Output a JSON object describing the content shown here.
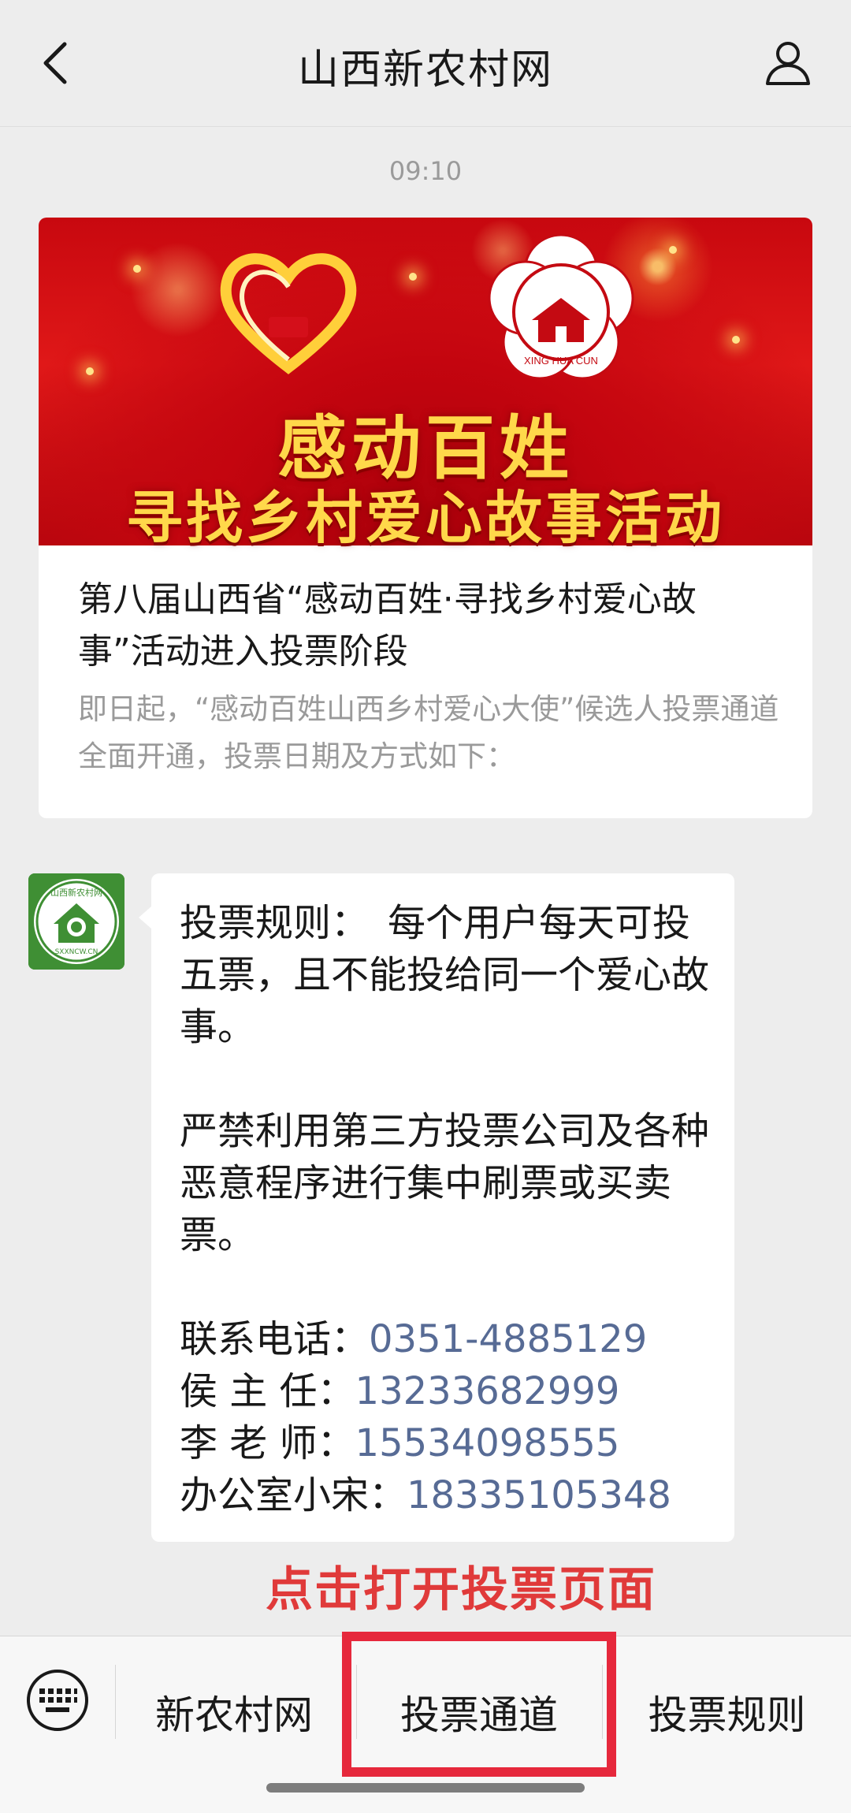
{
  "header": {
    "title": "山西新农村网",
    "back_icon": "chevron-left-icon",
    "profile_icon": "person-icon"
  },
  "timestamp": "09:10",
  "article": {
    "banner": {
      "line1": "感动百姓",
      "line2": "寻找乡村爱心故事活动",
      "flower_logo_text": "XING HUA CUN"
    },
    "title": "第八届山西省“感动百姓·寻找乡村爱心故事”活动进入投票阶段",
    "description": "即日起，“感动百姓山西乡村爱心大使”候选人投票通道全面开通，投票日期及方式如下："
  },
  "message": {
    "avatar_text": "山西新农村网",
    "avatar_site": "SXXNCW.CN",
    "paragraph1": "投票规则：　每个用户每天可投五票，且不能投给同一个爱心故事。",
    "paragraph2": "严禁利用第三方投票公司及各种恶意程序进行集中刷票或买卖票。",
    "contacts": [
      {
        "label": "联系电话：",
        "phone": "0351-4885129"
      },
      {
        "label": "侯 主 任：",
        "phone": "13233682999"
      },
      {
        "label": "李 老 师：",
        "phone": "15534098555"
      },
      {
        "label": "办公室小宋：",
        "phone": "18335105348"
      }
    ]
  },
  "annotation": "点击打开投票页面",
  "menu": {
    "keyboard_icon": "keyboard-icon",
    "items": [
      "新农村网",
      "投票通道",
      "投票规则"
    ]
  },
  "colors": {
    "background": "#ededed",
    "link": "#576b95",
    "highlight": "#e6283c",
    "annotation": "#e03a3a"
  }
}
